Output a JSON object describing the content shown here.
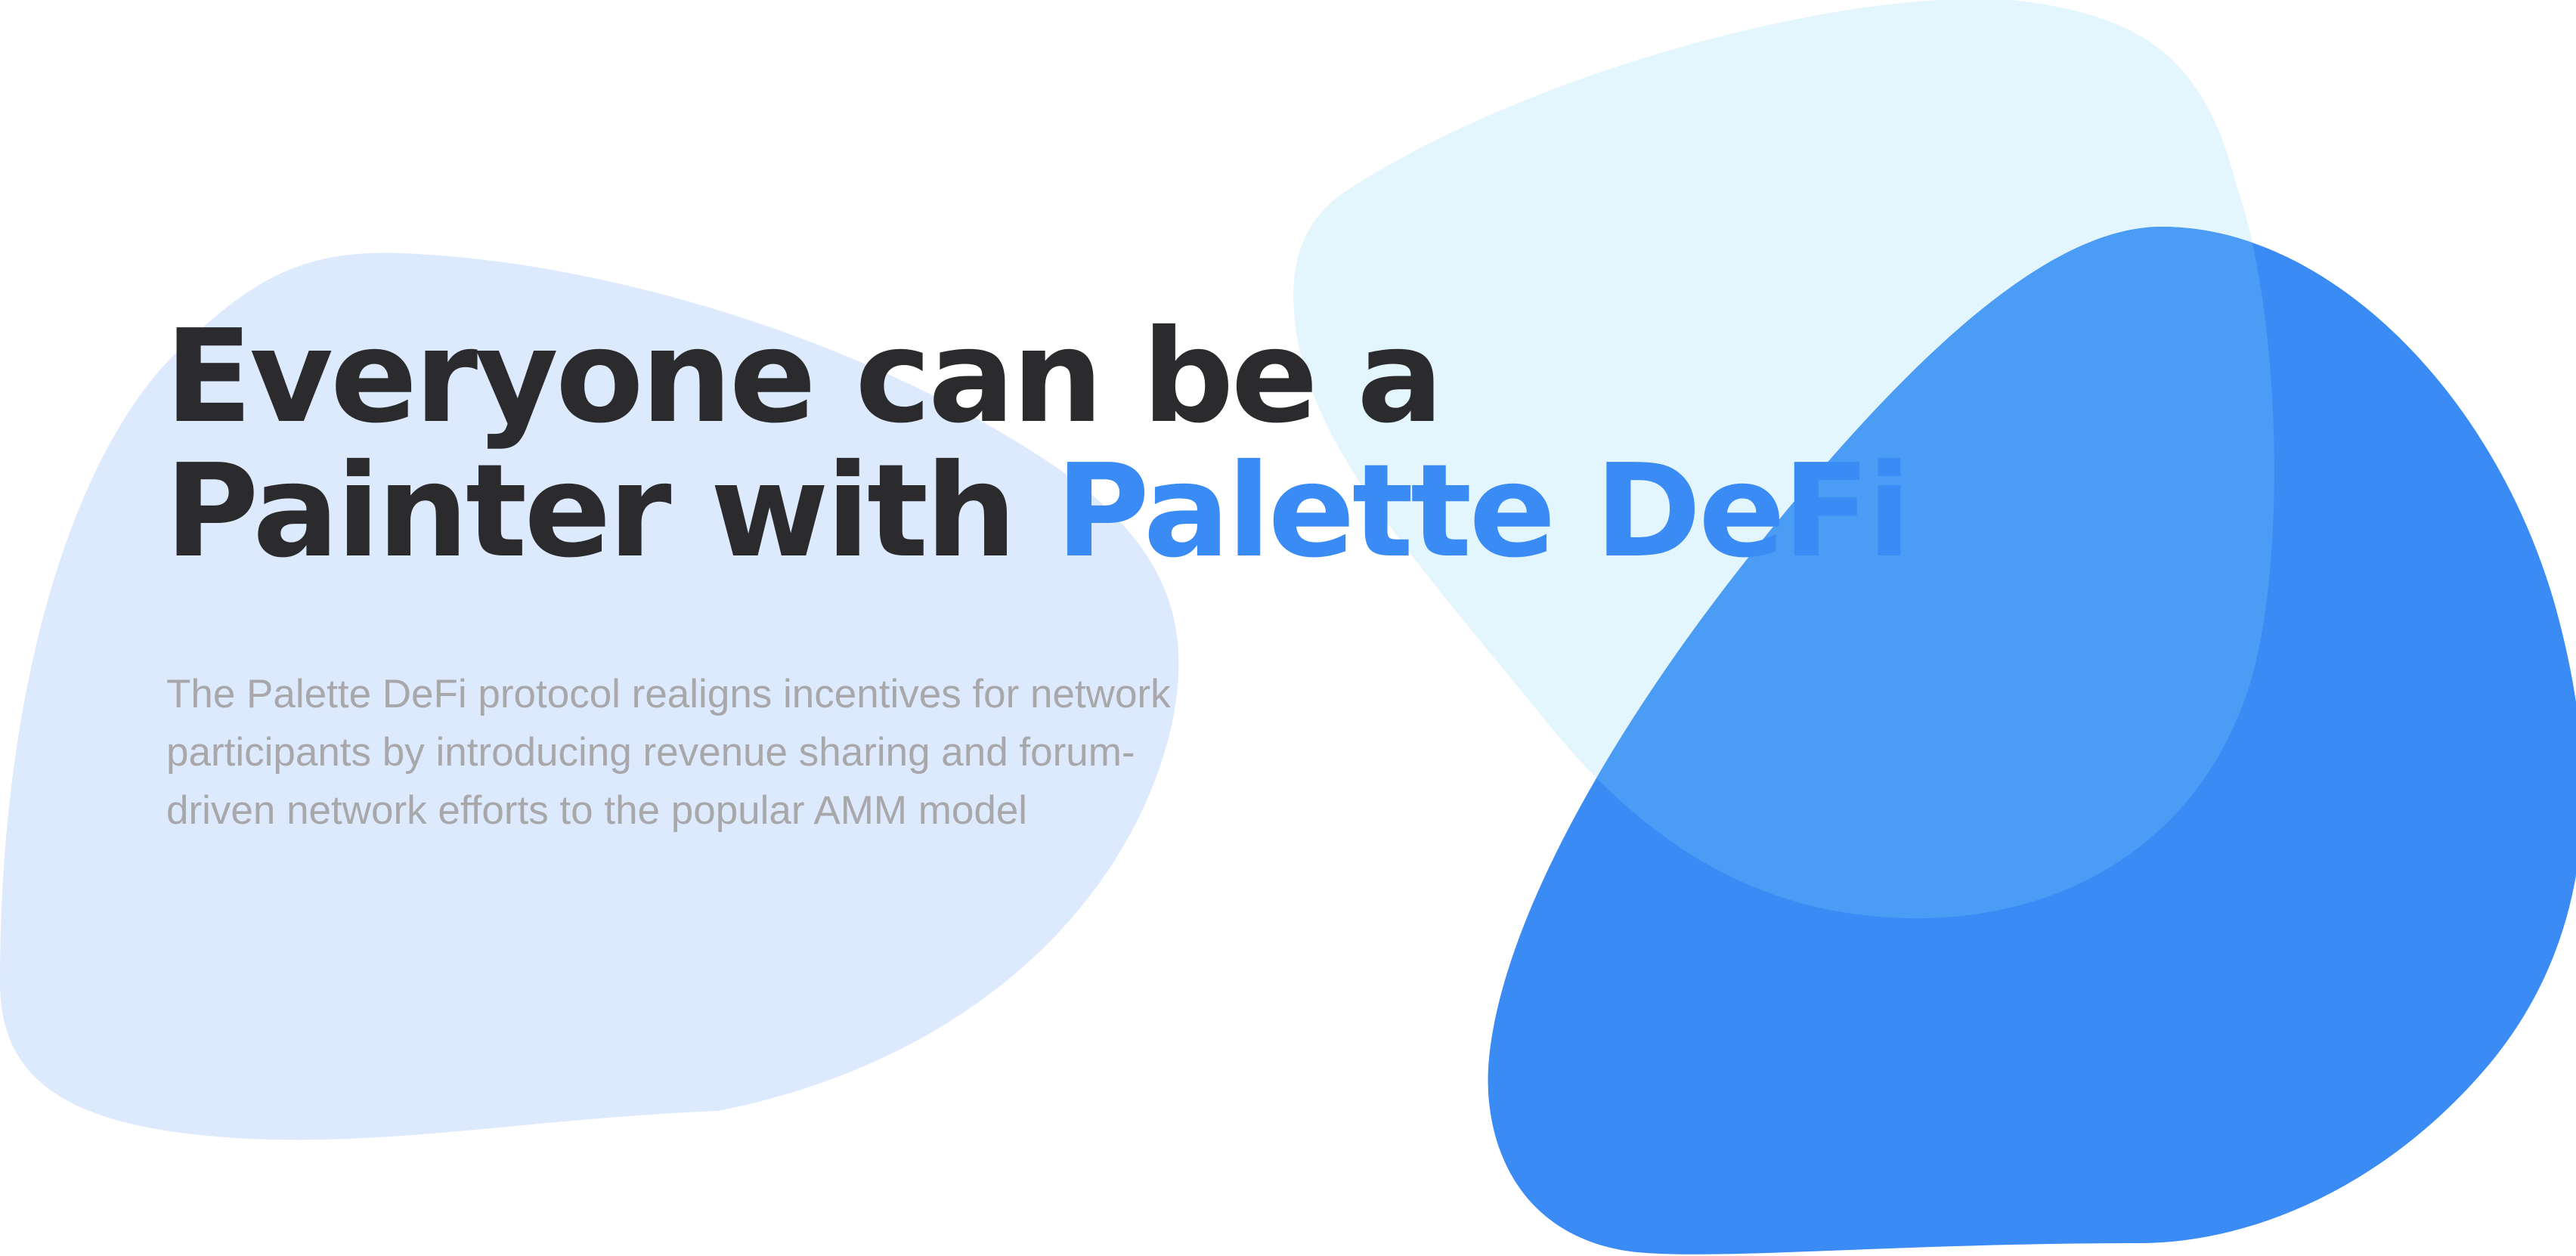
{
  "hero": {
    "headline_line1": "Everyone can be a",
    "headline_line2_prefix": "Painter with ",
    "headline_line2_accent": "Palette DeFi",
    "subtext_line1": "The Palette DeFi protocol realigns incentives for network",
    "subtext_line2": "participants by introducing revenue sharing and forum-",
    "subtext_line3": "driven network efforts to the popular AMM model"
  },
  "colors": {
    "accent": "#3b8bf4",
    "headline": "#2b2b2e",
    "subtext": "#a8a8ab",
    "blob_left": "#dde9fc",
    "blob_back": "#e3f5fd",
    "blob_front": "#3b8bf4",
    "blob_overlap": "#4b9cf5"
  }
}
